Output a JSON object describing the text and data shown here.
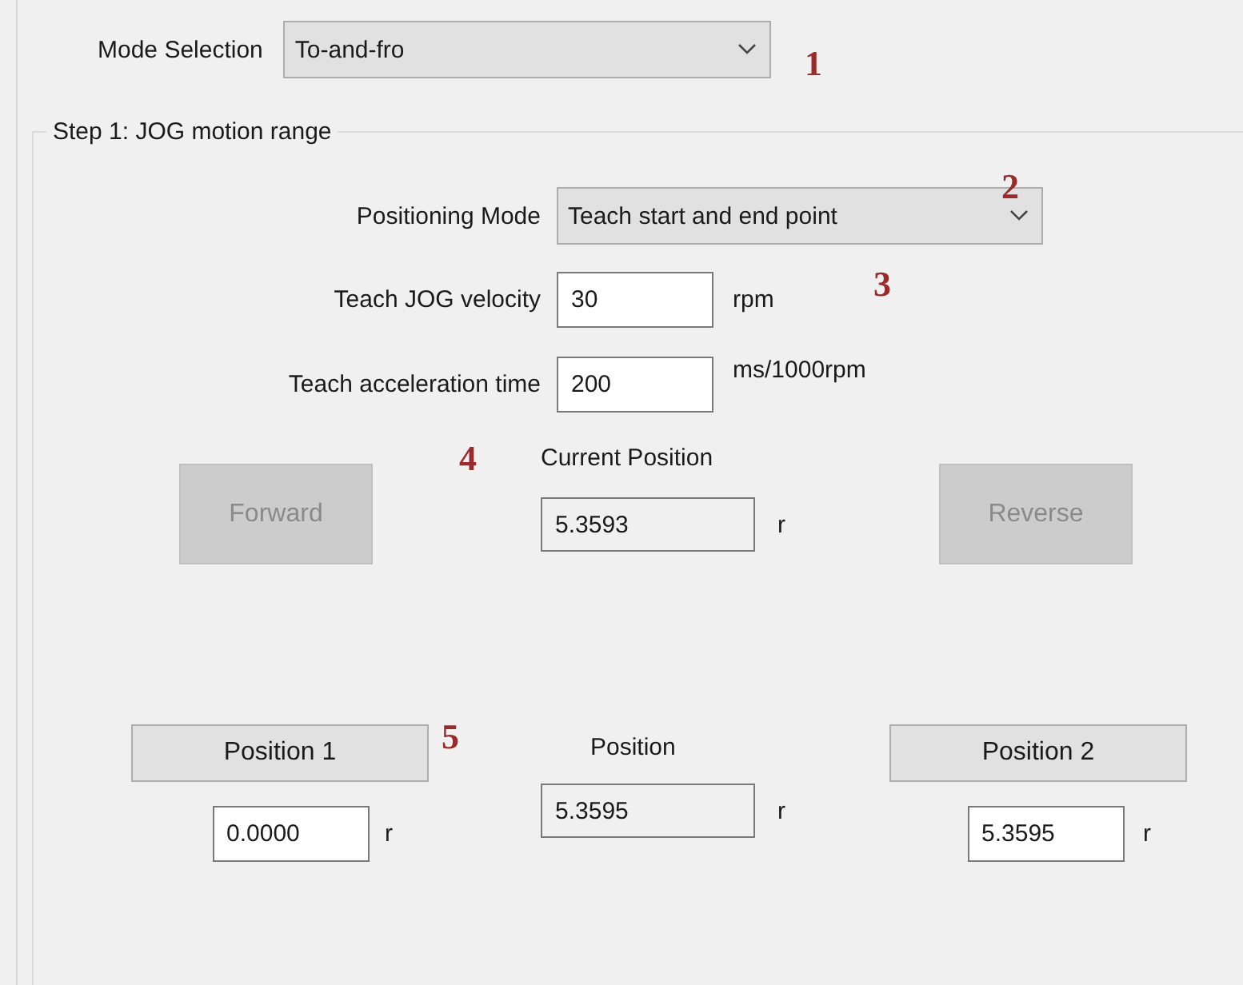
{
  "mode_selection": {
    "label": "Mode Selection",
    "value": "To-and-fro"
  },
  "step1": {
    "title": "Step 1: JOG motion range",
    "fields": [
      {
        "kind": "select",
        "label": "Positioning Mode",
        "value": "Teach start and end point"
      },
      {
        "kind": "input",
        "label": "Teach JOG velocity",
        "value": "30",
        "unit": "rpm"
      },
      {
        "kind": "input",
        "label": "Teach acceleration time",
        "value": "200",
        "unit": "ms/1000rpm"
      }
    ],
    "jog_buttons": [
      {
        "label": "Forward",
        "disabled": true
      },
      {
        "label": "Reverse",
        "disabled": true
      }
    ],
    "current_position": {
      "label": "Current Position",
      "value": "5.3593",
      "unit": "r"
    },
    "position_1": {
      "button": "Position 1",
      "value": "0.0000",
      "unit": "r"
    },
    "position": {
      "label": "Position",
      "value": "5.3595",
      "unit": "r"
    },
    "position_2": {
      "button": "Position 2",
      "value": "5.3595",
      "unit": "r"
    }
  },
  "annotations": [
    "1",
    "2",
    "3",
    "4",
    "5"
  ]
}
